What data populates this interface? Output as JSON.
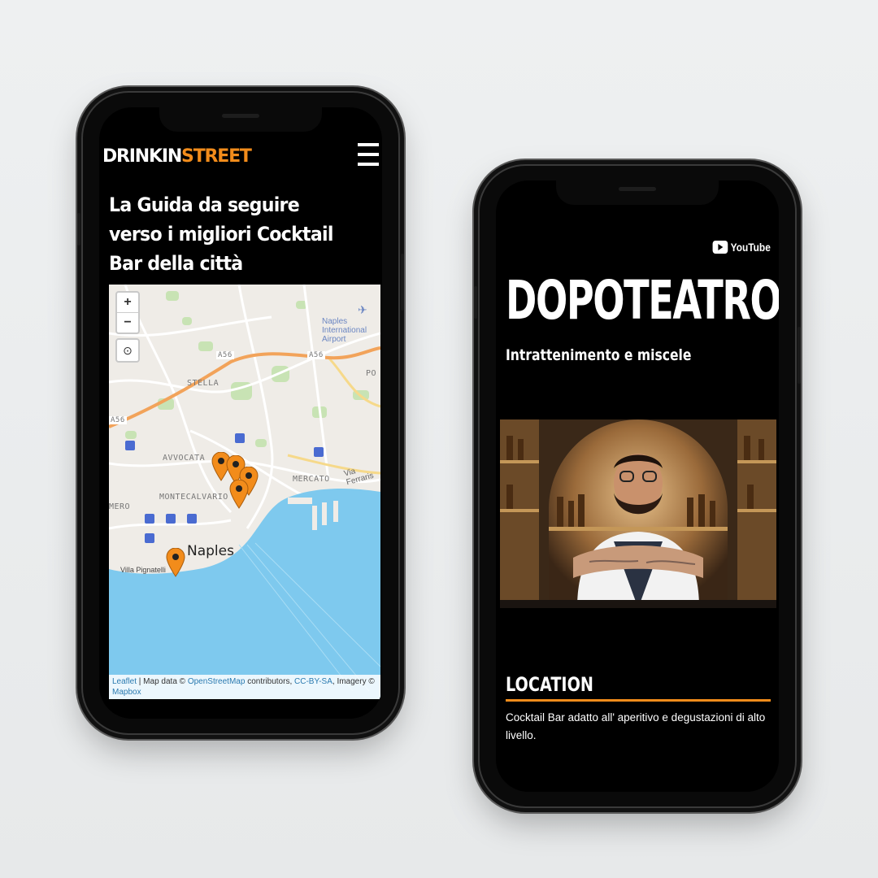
{
  "left_phone": {
    "logo": {
      "part1": "DRINKIN",
      "part2": "STREET"
    },
    "headline": "La Guida da seguire verso i migliori Cocktail Bar della città",
    "map": {
      "zoom_in": "+",
      "zoom_out": "−",
      "labels": {
        "airport": "Naples International Airport",
        "a56_left": "A56",
        "a56_right": "A56",
        "a56_far": "A56",
        "stella": "STELLA",
        "avvocata": "AVVOCATA",
        "mercato": "MERCATO",
        "montecalvario": "MONTECALVARIO",
        "naples": "Naples",
        "villa": "Villa Pignatelli",
        "via_ferraris": "Via Ferraris",
        "po": "PO",
        "mero": "MERO"
      },
      "attribution": {
        "leaflet": "Leaflet",
        "map_data": " | Map data © ",
        "osm": "OpenStreetMap",
        "contributors": " contributors, ",
        "license": "CC-BY-SA",
        "imagery": ", Imagery © ",
        "mapbox": "Mapbox"
      }
    }
  },
  "right_phone": {
    "youtube": "YouTube",
    "title": "DOPOTEATRO",
    "subtitle": "Intrattenimento e miscele",
    "section_heading": "LOCATION",
    "section_text": "Cocktail Bar adatto all' aperitivo e degustazioni di alto livello."
  },
  "colors": {
    "accent": "#f28c1b",
    "sea": "#7ec9ee",
    "link": "#2a7ab0"
  }
}
